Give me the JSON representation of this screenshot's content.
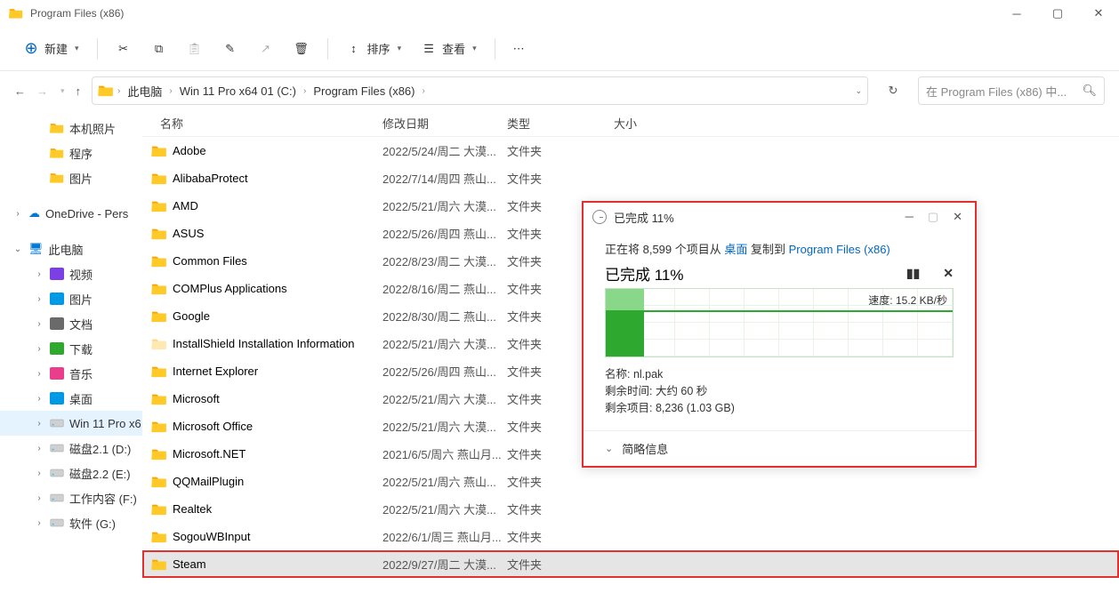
{
  "window": {
    "title": "Program Files (x86)"
  },
  "toolbar": {
    "new": "新建",
    "sort": "排序",
    "view": "查看"
  },
  "breadcrumb": [
    "此电脑",
    "Win 11 Pro x64 01 (C:)",
    "Program Files (x86)"
  ],
  "breadcrumb_dropdown_open": false,
  "search": {
    "placeholder": "在 Program Files (x86) 中..."
  },
  "sidebar": {
    "top": [
      {
        "label": "本机照片",
        "icon": "folder"
      },
      {
        "label": "程序",
        "icon": "folder"
      },
      {
        "label": "图片",
        "icon": "folder"
      }
    ],
    "onedrive": "OneDrive - Pers",
    "thispc": "此电脑",
    "pcitems": [
      {
        "label": "视频",
        "color": "#7b3fe4"
      },
      {
        "label": "图片",
        "color": "#0099e5"
      },
      {
        "label": "文档",
        "color": "#6a6a6a"
      },
      {
        "label": "下载",
        "color": "#2ea82e"
      },
      {
        "label": "音乐",
        "color": "#e83e8c"
      },
      {
        "label": "桌面",
        "color": "#0099e5"
      }
    ],
    "drives": [
      {
        "label": "Win 11 Pro x6",
        "selected": true
      },
      {
        "label": "磁盘2.1 (D:)"
      },
      {
        "label": "磁盘2.2 (E:)"
      },
      {
        "label": "工作内容 (F:)"
      },
      {
        "label": "软件 (G:)"
      }
    ]
  },
  "columns": {
    "name": "名称",
    "date": "修改日期",
    "type": "类型",
    "size": "大小"
  },
  "files": [
    {
      "name": "Adobe",
      "date": "2022/5/24/周二 大漠...",
      "type": "文件夹"
    },
    {
      "name": "AlibabaProtect",
      "date": "2022/7/14/周四 燕山...",
      "type": "文件夹"
    },
    {
      "name": "AMD",
      "date": "2022/5/21/周六 大漠...",
      "type": "文件夹"
    },
    {
      "name": "ASUS",
      "date": "2022/5/26/周四 燕山...",
      "type": "文件夹"
    },
    {
      "name": "Common Files",
      "date": "2022/8/23/周二 大漠...",
      "type": "文件夹"
    },
    {
      "name": "COMPlus Applications",
      "date": "2022/8/16/周二 燕山...",
      "type": "文件夹"
    },
    {
      "name": "Google",
      "date": "2022/8/30/周二 燕山...",
      "type": "文件夹"
    },
    {
      "name": "InstallShield Installation Information",
      "date": "2022/5/21/周六 大漠...",
      "type": "文件夹",
      "faded": true
    },
    {
      "name": "Internet Explorer",
      "date": "2022/5/26/周四 燕山...",
      "type": "文件夹"
    },
    {
      "name": "Microsoft",
      "date": "2022/5/21/周六 大漠...",
      "type": "文件夹"
    },
    {
      "name": "Microsoft Office",
      "date": "2022/5/21/周六 大漠...",
      "type": "文件夹"
    },
    {
      "name": "Microsoft.NET",
      "date": "2021/6/5/周六 燕山月...",
      "type": "文件夹"
    },
    {
      "name": "QQMailPlugin",
      "date": "2022/5/21/周六 燕山...",
      "type": "文件夹"
    },
    {
      "name": "Realtek",
      "date": "2022/5/21/周六 大漠...",
      "type": "文件夹"
    },
    {
      "name": "SogouWBInput",
      "date": "2022/6/1/周三 燕山月...",
      "type": "文件夹"
    },
    {
      "name": "Steam",
      "date": "2022/9/27/周二 大漠...",
      "type": "文件夹",
      "highlighted": true
    }
  ],
  "copyDialog": {
    "title": "已完成 11%",
    "desc_prefix": "正在将 8,599 个项目从 ",
    "desc_src": "桌面",
    "desc_mid": " 复制到 ",
    "desc_dst": "Program Files (x86)",
    "status": "已完成 11%",
    "speed": "速度: 15.2 KB/秒",
    "name_label": "名称: ",
    "name_value": "nl.pak",
    "time_label": "剩余时间: ",
    "time_value": "大约 60 秒",
    "items_label": "剩余项目: ",
    "items_value": "8,236 (1.03 GB)",
    "footer": "简略信息"
  }
}
